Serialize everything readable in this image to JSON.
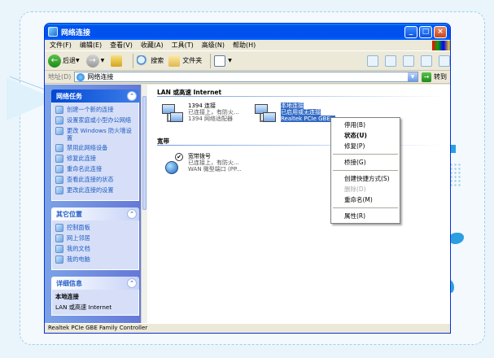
{
  "window": {
    "title": "网络连接"
  },
  "menubar": {
    "items": [
      "文件(F)",
      "编辑(E)",
      "查看(V)",
      "收藏(A)",
      "工具(T)",
      "高级(N)",
      "帮助(H)"
    ]
  },
  "toolbar": {
    "back": "后退",
    "search": "搜索",
    "folders": "文件夹"
  },
  "address": {
    "label": "地址(D)",
    "value": "网络连接",
    "go": "转到"
  },
  "left_panel": {
    "tasks": {
      "title": "网络任务",
      "items": [
        "创建一个新的连接",
        "设置家庭或小型办公网络",
        "更改 Windows 防火墙设置",
        "禁用此网络设备",
        "修复此连接",
        "重命名此连接",
        "查看此连接的状态",
        "更改此连接的设置"
      ]
    },
    "other": {
      "title": "其它位置",
      "items": [
        "控制面板",
        "网上邻居",
        "我的文档",
        "我的电脑"
      ]
    },
    "details": {
      "title": "详细信息",
      "strong": "本地连接",
      "text": "LAN 或高速 Internet"
    }
  },
  "main": {
    "section_lan": "LAN 或高速 Internet",
    "section_broadband": "宽带",
    "conn_1394": {
      "name": "1394 连接",
      "status": "已连接上，有防火...",
      "device": "1394 网络适配器"
    },
    "conn_local": {
      "name": "本地连接",
      "status": "已启用或无连接",
      "device": "Realtek PCIe GBE..."
    },
    "conn_broadband": {
      "name": "宽带拨号",
      "status": "已连接上，有防火...",
      "device": "WAN 微型端口 (PP..."
    }
  },
  "context_menu": {
    "items": [
      "停用(B)",
      "状态(U)",
      "修复(P)",
      "桥接(G)",
      "创建快捷方式(S)",
      "删除(D)",
      "重命名(M)",
      "属性(R)"
    ]
  },
  "statusbar": {
    "text": "Realtek PCIe GBE Family Controller"
  }
}
